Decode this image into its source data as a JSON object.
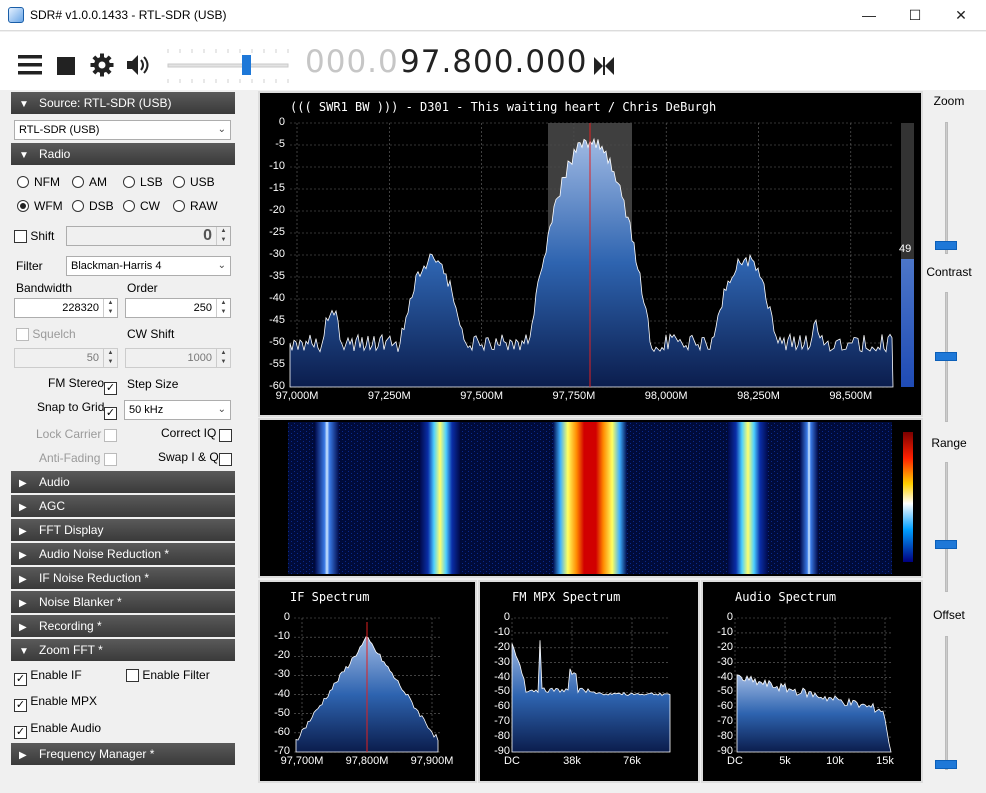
{
  "window": {
    "title": "SDR# v1.0.0.1433 - RTL-SDR (USB)",
    "minimize": "—",
    "maximize": "☐",
    "close": "✕"
  },
  "toolbar": {
    "freq_dim": "000.0",
    "freq_main": "97.800.000",
    "volume_level": 0.6
  },
  "source": {
    "header": "Source: RTL-SDR (USB)",
    "device": "RTL-SDR (USB)"
  },
  "radio": {
    "header": "Radio",
    "modes": [
      {
        "label": "NFM",
        "selected": false
      },
      {
        "label": "AM",
        "selected": false
      },
      {
        "label": "LSB",
        "selected": false
      },
      {
        "label": "USB",
        "selected": false
      },
      {
        "label": "WFM",
        "selected": true
      },
      {
        "label": "DSB",
        "selected": false
      },
      {
        "label": "CW",
        "selected": false
      },
      {
        "label": "RAW",
        "selected": false
      }
    ],
    "shift_label": "Shift",
    "shift_value": "0",
    "filter_label": "Filter",
    "filter_value": "Blackman-Harris 4",
    "bandwidth_label": "Bandwidth",
    "bandwidth_value": "228320",
    "order_label": "Order",
    "order_value": "250",
    "squelch_label": "Squelch",
    "squelch_value": "50",
    "cwshift_label": "CW Shift",
    "cwshift_value": "1000",
    "fmstereo_label": "FM Stereo",
    "stepsize_label": "Step Size",
    "snap_label": "Snap to Grid",
    "step_value": "50 kHz",
    "lockcarrier_label": "Lock Carrier",
    "correctiq_label": "Correct IQ",
    "antifading_label": "Anti-Fading",
    "swapiq_label": "Swap I & Q"
  },
  "panels": [
    "Audio",
    "AGC",
    "FFT Display",
    "Audio Noise Reduction *",
    "IF Noise Reduction *",
    "Noise Blanker *",
    "Recording *"
  ],
  "zoomfft": {
    "header": "Zoom FFT *",
    "enable_if": "Enable IF",
    "enable_filter": "Enable Filter",
    "enable_mpx": "Enable MPX",
    "enable_audio": "Enable Audio"
  },
  "freqmgr": {
    "header": "Frequency Manager *"
  },
  "spectrum": {
    "rds": "((( SWR1 BW  ))) - D301 - This waiting heart / Chris DeBurgh",
    "y_ticks": [
      "0",
      "-5",
      "-10",
      "-15",
      "-20",
      "-25",
      "-30",
      "-35",
      "-40",
      "-45",
      "-50",
      "-55",
      "-60"
    ],
    "x_ticks": [
      "97,000M",
      "97,250M",
      "97,500M",
      "97,750M",
      "98,000M",
      "98,250M",
      "98,500M"
    ],
    "snr": "49"
  },
  "if_spectrum": {
    "title": "IF Spectrum",
    "y_ticks": [
      "0",
      "-10",
      "-20",
      "-30",
      "-40",
      "-50",
      "-60",
      "-70"
    ],
    "x_ticks": [
      "97,700M",
      "97,800M",
      "97,900M"
    ]
  },
  "mpx_spectrum": {
    "title": "FM MPX Spectrum",
    "y_ticks": [
      "0",
      "-10",
      "-20",
      "-30",
      "-40",
      "-50",
      "-60",
      "-70",
      "-80",
      "-90"
    ],
    "x_ticks": [
      "DC",
      "38k",
      "76k"
    ]
  },
  "audio_spectrum": {
    "title": "Audio Spectrum",
    "y_ticks": [
      "0",
      "-10",
      "-20",
      "-30",
      "-40",
      "-50",
      "-60",
      "-70",
      "-80",
      "-90"
    ],
    "x_ticks": [
      "DC",
      "5k",
      "10k",
      "15k"
    ]
  },
  "sliders": {
    "zoom": "Zoom",
    "contrast": "Contrast",
    "range": "Range",
    "offset": "Offset"
  },
  "colors": {
    "accent": "#1e78d8",
    "spectrum_fill": "#1b4f9a",
    "cursor": "#e02020"
  }
}
